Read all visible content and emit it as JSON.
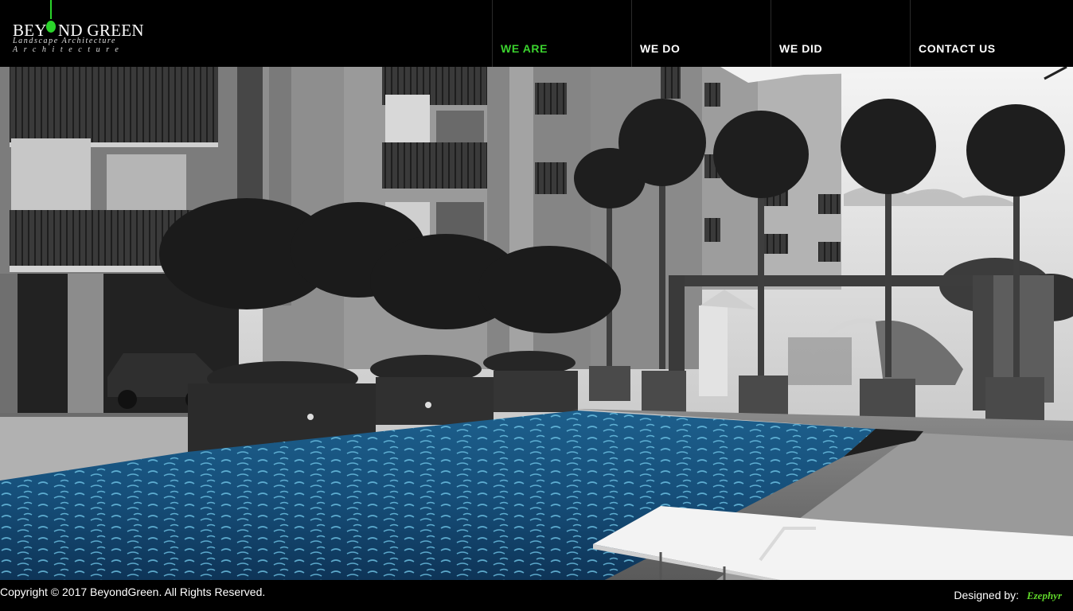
{
  "logo": {
    "title_left": "BEY",
    "title_right": "ND GREEN",
    "subtitle": "Landscape Architecture",
    "subtitle2": "Architecture",
    "accent_color": "#2ad42a"
  },
  "nav": {
    "active_color": "#3bd22e",
    "items": [
      {
        "label": "WE ARE",
        "active": true
      },
      {
        "label": "WE DO",
        "active": false
      },
      {
        "label": "WE DID",
        "active": false
      },
      {
        "label": "CONTACT US",
        "active": false
      }
    ]
  },
  "hero": {
    "image": "grayscale building with palm trees and blue swimming pool",
    "pool_color": "#1a6a9c"
  },
  "footer": {
    "copyright": "Copyright © 2017 BeyondGreen. All Rights Reserved.",
    "designed_by_label": "Designed by:",
    "designer": "Ezephyr"
  }
}
